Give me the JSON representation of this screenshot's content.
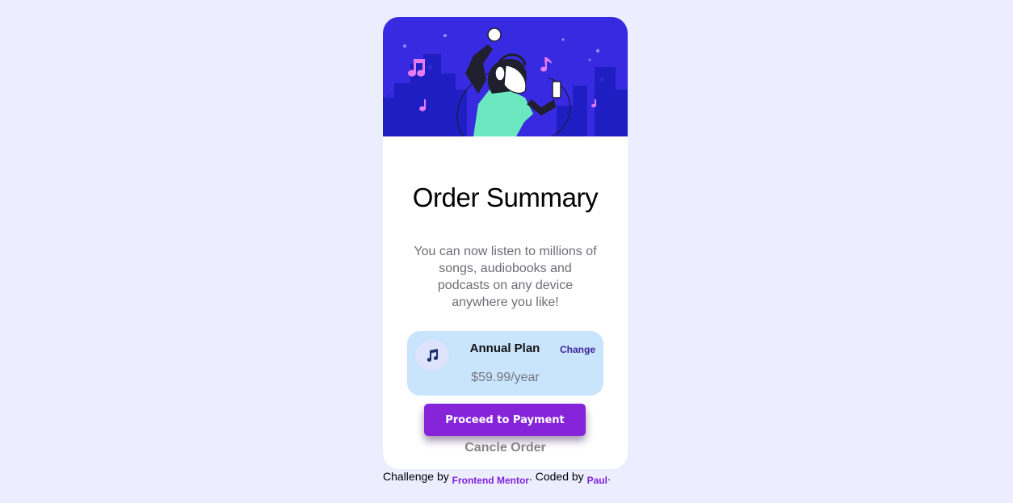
{
  "card": {
    "title": "Order Summary",
    "description": "You can now listen to millions of songs, audiobooks and podcasts on any device anywhere you like!",
    "plan": {
      "icon": "music-note-icon",
      "name": "Annual Plan",
      "change_label": "Change",
      "price": "$59.99/year"
    },
    "pay_label": "Proceed to Payment",
    "cancel_label": "Cancle Order"
  },
  "attribution": {
    "challenge_prefix": "Challenge by",
    "challenge_link": "Frontend Mentor",
    "separator": ".",
    "coded_prefix": "Coded by",
    "coded_link": "Paul",
    "end": "."
  },
  "colors": {
    "page_background": "#ECEEFF",
    "hero_background": "#382AE1",
    "plan_background": "#C9E4FD",
    "accent_purple": "#8624DA",
    "change_link": "#3e2499"
  }
}
